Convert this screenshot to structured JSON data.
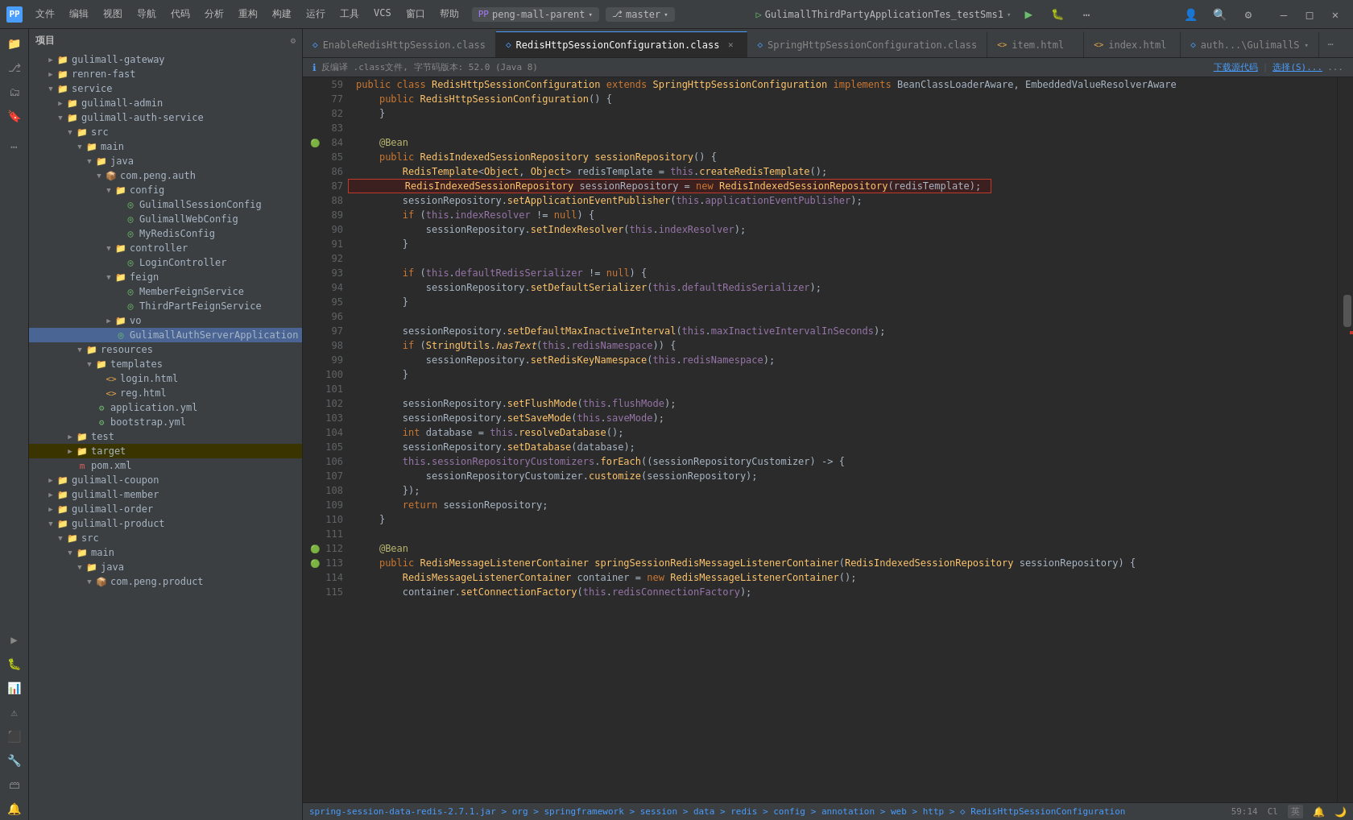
{
  "titlebar": {
    "icon": "PP",
    "menu": [
      "文件",
      "编辑",
      "视图",
      "导航",
      "代码",
      "分析",
      "重构",
      "构建",
      "运行",
      "工具",
      "VCS",
      "窗口",
      "帮助"
    ],
    "project": "peng-mall-parent",
    "branch": "master",
    "run_config": "GulimallThirdPartyApplicationTes_testSms1",
    "win_minimize": "—",
    "win_maximize": "□",
    "win_close": "✕"
  },
  "tabs": [
    {
      "id": "tab1",
      "label": "EnableRedisHttpSession.class",
      "icon": "◇",
      "icon_color": "#4a9eff",
      "active": false,
      "closable": false
    },
    {
      "id": "tab2",
      "label": "RedisHttpSessionConfiguration.class",
      "icon": "◇",
      "icon_color": "#4a9eff",
      "active": true,
      "closable": true
    },
    {
      "id": "tab3",
      "label": "SpringHttpSessionConfiguration.class",
      "icon": "◇",
      "icon_color": "#4a9eff",
      "active": false,
      "closable": false
    },
    {
      "id": "tab4",
      "label": "item.html",
      "icon": "<>",
      "icon_color": "#e8a84c",
      "active": false,
      "closable": false
    },
    {
      "id": "tab5",
      "label": "index.html",
      "icon": "<>",
      "icon_color": "#e8a84c",
      "active": false,
      "closable": false
    },
    {
      "id": "tab6",
      "label": "auth...\\GulimallS",
      "icon": "◇",
      "icon_color": "#4a9eff",
      "active": false,
      "closable": false
    }
  ],
  "info_bar": {
    "text": "反编译 .class文件, 字节码版本: 52.0 (Java 8)",
    "download_source": "下载源代码",
    "choose": "选择(S)..."
  },
  "file_tree": {
    "title": "项目",
    "items": [
      {
        "id": "gateway",
        "level": 1,
        "label": "gulimall-gateway",
        "type": "folder",
        "expanded": false
      },
      {
        "id": "renren",
        "level": 1,
        "label": "renren-fast",
        "type": "folder",
        "expanded": false
      },
      {
        "id": "service",
        "level": 1,
        "label": "service",
        "type": "folder",
        "expanded": true
      },
      {
        "id": "admin",
        "level": 2,
        "label": "gulimall-admin",
        "type": "folder",
        "expanded": false
      },
      {
        "id": "auth",
        "level": 2,
        "label": "gulimall-auth-service",
        "type": "folder",
        "expanded": true
      },
      {
        "id": "src_auth",
        "level": 3,
        "label": "src",
        "type": "folder",
        "expanded": true
      },
      {
        "id": "main_auth",
        "level": 4,
        "label": "main",
        "type": "folder",
        "expanded": true
      },
      {
        "id": "java_auth",
        "level": 5,
        "label": "java",
        "type": "folder",
        "expanded": true
      },
      {
        "id": "com_peng",
        "level": 6,
        "label": "com.peng.auth",
        "type": "package",
        "expanded": true
      },
      {
        "id": "config_pkg",
        "level": 7,
        "label": "config",
        "type": "folder",
        "expanded": true
      },
      {
        "id": "gulimall_session",
        "level": 8,
        "label": "GulimallSessionConfig",
        "type": "class",
        "expanded": false
      },
      {
        "id": "gulimall_web",
        "level": 8,
        "label": "GulimallWebConfig",
        "type": "class",
        "expanded": false
      },
      {
        "id": "my_redis",
        "level": 8,
        "label": "MyRedisConfig",
        "type": "class",
        "expanded": false
      },
      {
        "id": "controller_pkg",
        "level": 7,
        "label": "controller",
        "type": "folder",
        "expanded": true
      },
      {
        "id": "login_ctrl",
        "level": 8,
        "label": "LoginController",
        "type": "class",
        "expanded": false
      },
      {
        "id": "feign_pkg",
        "level": 7,
        "label": "feign",
        "type": "folder",
        "expanded": true
      },
      {
        "id": "member_feign",
        "level": 8,
        "label": "MemberFeignService",
        "type": "interface",
        "expanded": false
      },
      {
        "id": "third_feign",
        "level": 8,
        "label": "ThirdPartFeignService",
        "type": "interface",
        "expanded": false
      },
      {
        "id": "vo_pkg",
        "level": 7,
        "label": "vo",
        "type": "folder",
        "expanded": false
      },
      {
        "id": "gulimall_app",
        "level": 7,
        "label": "GulimallAuthServerApplication",
        "type": "class",
        "expanded": false,
        "selected": true
      },
      {
        "id": "resources_auth",
        "level": 4,
        "label": "resources",
        "type": "folder",
        "expanded": true
      },
      {
        "id": "templates_pkg",
        "level": 5,
        "label": "templates",
        "type": "folder",
        "expanded": true
      },
      {
        "id": "login_html",
        "level": 6,
        "label": "login.html",
        "type": "html",
        "expanded": false
      },
      {
        "id": "reg_html",
        "level": 6,
        "label": "reg.html",
        "type": "html",
        "expanded": false
      },
      {
        "id": "app_yaml",
        "level": 5,
        "label": "application.yml",
        "type": "yaml",
        "expanded": false
      },
      {
        "id": "bootstrap_yaml",
        "level": 5,
        "label": "bootstrap.yml",
        "type": "yaml",
        "expanded": false
      },
      {
        "id": "test_auth",
        "level": 3,
        "label": "test",
        "type": "folder",
        "expanded": false
      },
      {
        "id": "target_auth",
        "level": 3,
        "label": "target",
        "type": "folder_target",
        "expanded": false
      },
      {
        "id": "pom_auth",
        "level": 3,
        "label": "pom.xml",
        "type": "pom",
        "expanded": false
      },
      {
        "id": "coupon",
        "level": 1,
        "label": "gulimall-coupon",
        "type": "folder",
        "expanded": false
      },
      {
        "id": "member",
        "level": 1,
        "label": "gulimall-member",
        "type": "folder",
        "expanded": false
      },
      {
        "id": "order",
        "level": 1,
        "label": "gulimall-order",
        "type": "folder",
        "expanded": false
      },
      {
        "id": "product",
        "level": 1,
        "label": "gulimall-product",
        "type": "folder",
        "expanded": true
      },
      {
        "id": "src_product",
        "level": 2,
        "label": "src",
        "type": "folder",
        "expanded": true
      },
      {
        "id": "main_product",
        "level": 3,
        "label": "main",
        "type": "folder",
        "expanded": true
      },
      {
        "id": "java_product",
        "level": 4,
        "label": "java",
        "type": "folder",
        "expanded": true
      },
      {
        "id": "com_peng_product",
        "level": 5,
        "label": "com.peng.product",
        "type": "package",
        "expanded": true
      }
    ]
  },
  "code": {
    "lines": [
      {
        "num": 59,
        "content": "public class RedisHttpSessionConfiguration extends SpringHttpSessionConfiguration implements BeanClassLoaderAware, EmbeddedValueResolverAware",
        "type": "normal"
      },
      {
        "num": 77,
        "content": "    public RedisHttpSessionConfiguration() {",
        "type": "normal"
      },
      {
        "num": 82,
        "content": "    }",
        "type": "normal"
      },
      {
        "num": 83,
        "content": "",
        "type": "normal"
      },
      {
        "num": 84,
        "content": "    @Bean",
        "type": "annotation",
        "gutter": true
      },
      {
        "num": 85,
        "content": "    public RedisIndexedSessionRepository sessionRepository() {",
        "type": "normal"
      },
      {
        "num": 86,
        "content": "        RedisTemplate<Object, Object> redisTemplate = this.createRedisTemplate();",
        "type": "normal"
      },
      {
        "num": 87,
        "content": "        RedisIndexedSessionRepository sessionRepository = new RedisIndexedSessionRepository(redisTemplate);",
        "type": "highlighted"
      },
      {
        "num": 88,
        "content": "        sessionRepository.setApplicationEventPublisher(this.applicationEventPublisher);",
        "type": "normal"
      },
      {
        "num": 89,
        "content": "        if (this.indexResolver != null) {",
        "type": "normal"
      },
      {
        "num": 90,
        "content": "            sessionRepository.setIndexResolver(this.indexResolver);",
        "type": "normal"
      },
      {
        "num": 91,
        "content": "        }",
        "type": "normal"
      },
      {
        "num": 92,
        "content": "",
        "type": "normal"
      },
      {
        "num": 93,
        "content": "        if (this.defaultRedisSerializer != null) {",
        "type": "normal"
      },
      {
        "num": 94,
        "content": "            sessionRepository.setDefaultSerializer(this.defaultRedisSerializer);",
        "type": "normal"
      },
      {
        "num": 95,
        "content": "        }",
        "type": "normal"
      },
      {
        "num": 96,
        "content": "",
        "type": "normal"
      },
      {
        "num": 97,
        "content": "        sessionRepository.setDefaultMaxInactiveInterval(this.maxInactiveIntervalInSeconds);",
        "type": "normal"
      },
      {
        "num": 98,
        "content": "        if (StringUtils.hasText(this.redisNamespace)) {",
        "type": "normal"
      },
      {
        "num": 99,
        "content": "            sessionRepository.setRedisKeyNamespace(this.redisNamespace);",
        "type": "normal"
      },
      {
        "num": 100,
        "content": "        }",
        "type": "normal"
      },
      {
        "num": 101,
        "content": "",
        "type": "normal"
      },
      {
        "num": 102,
        "content": "        sessionRepository.setFlushMode(this.flushMode);",
        "type": "normal"
      },
      {
        "num": 103,
        "content": "        sessionRepository.setSaveMode(this.saveMode);",
        "type": "normal"
      },
      {
        "num": 104,
        "content": "        int database = this.resolveDatabase();",
        "type": "normal"
      },
      {
        "num": 105,
        "content": "        sessionRepository.setDatabase(database);",
        "type": "normal"
      },
      {
        "num": 106,
        "content": "        this.sessionRepositoryCustomizers.forEach((sessionRepositoryCustomizer) -> {",
        "type": "normal"
      },
      {
        "num": 107,
        "content": "            sessionRepositoryCustomizer.customize(sessionRepository);",
        "type": "normal"
      },
      {
        "num": 108,
        "content": "        });",
        "type": "normal"
      },
      {
        "num": 109,
        "content": "        return sessionRepository;",
        "type": "normal"
      },
      {
        "num": 110,
        "content": "    }",
        "type": "normal"
      },
      {
        "num": 111,
        "content": "",
        "type": "normal"
      },
      {
        "num": 112,
        "content": "    @Bean",
        "type": "annotation",
        "gutter": true
      },
      {
        "num": 113,
        "content": "    public RedisMessageListenerContainer springSessionRedisMessageListenerContainer(RedisIndexedSessionRepository sessionRepository) {",
        "type": "normal"
      },
      {
        "num": 114,
        "content": "        RedisMessageListenerContainer container = new RedisMessageListenerContainer();",
        "type": "normal"
      },
      {
        "num": 115,
        "content": "        container.setConnectionFactory(this.redisConnectionFactory);",
        "type": "normal"
      }
    ]
  },
  "breadcrumb": {
    "path": "spring-session-data-redis-2.7.1.jar > org > springframework > session > data > redis > config > annotation > web > http > RedisHttpSessionConfiguration",
    "position": "59:14",
    "encoding": "Cl"
  },
  "right_bar": {
    "download": "下载源代码",
    "select": "选择(S)..."
  },
  "sidebar_icons": {
    "items": [
      "☰",
      "⚙",
      "🔍",
      "📁",
      "⬛",
      "⬛",
      "🔧",
      "📊",
      "📋",
      "⬛",
      "⬛",
      "⬛",
      "⬛"
    ]
  },
  "status_bar": {
    "git": "⎇ spring-session-data-redis-2.7.1.jar",
    "lang": "英",
    "position": "59:14",
    "encoding": "Cl"
  }
}
